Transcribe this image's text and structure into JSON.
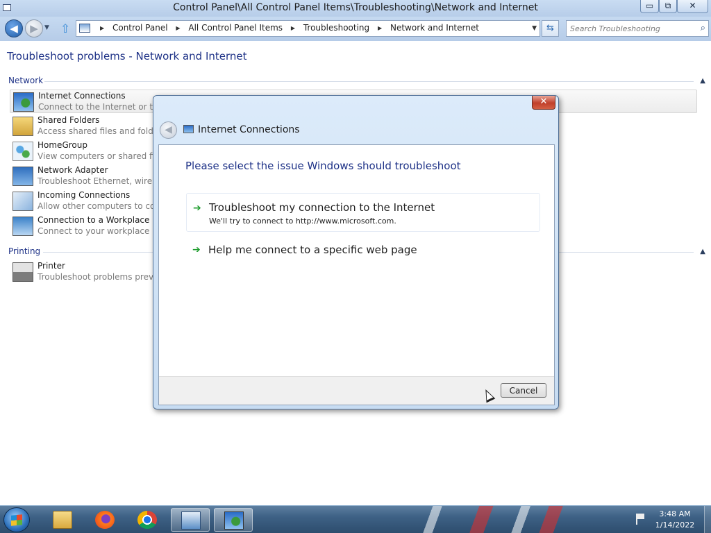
{
  "window": {
    "title": "Control Panel\\All Control Panel Items\\Troubleshooting\\Network and Internet",
    "minimize": "▭",
    "maximize": "⧉",
    "close": "✕"
  },
  "address_bar": {
    "breadcrumbs": [
      "Control Panel",
      "All Control Panel Items",
      "Troubleshooting",
      "Network and Internet"
    ],
    "search_placeholder": "Search Troubleshooting"
  },
  "page": {
    "title": "Troubleshoot problems - Network and Internet",
    "sections": [
      {
        "label": "Network",
        "items": [
          {
            "name": "Internet Connections",
            "desc": "Connect to the Internet or to a",
            "icon": "internet-connections-icon"
          },
          {
            "name": "Shared Folders",
            "desc": "Access shared files and folders o",
            "icon": "shared-folders-icon"
          },
          {
            "name": "HomeGroup",
            "desc": "View computers or shared files",
            "icon": "homegroup-icon"
          },
          {
            "name": "Network Adapter",
            "desc": "Troubleshoot Ethernet, wireless,",
            "icon": "network-adapter-icon"
          },
          {
            "name": "Incoming Connections",
            "desc": "Allow other computers to comm",
            "icon": "incoming-connections-icon"
          },
          {
            "name": "Connection to a Workplace Usin",
            "desc": "Connect to your workplace netw",
            "icon": "workplace-icon"
          }
        ]
      },
      {
        "label": "Printing",
        "items": [
          {
            "name": "Printer",
            "desc": "Troubleshoot problems prevent",
            "icon": "printer-icon"
          }
        ]
      }
    ]
  },
  "dialog": {
    "title": "Internet Connections",
    "close_label": "✕",
    "heading": "Please select the issue Windows should troubleshoot",
    "options": [
      {
        "title": "Troubleshoot my connection to the Internet",
        "subtitle": "We'll try to connect to http://www.microsoft.com."
      },
      {
        "title": "Help me connect to a specific web page",
        "subtitle": ""
      }
    ],
    "cancel_label": "Cancel"
  },
  "taskbar": {
    "pinned": [
      "windows-explorer",
      "firefox",
      "chrome",
      "control-panel",
      "troubleshooting"
    ],
    "time": "3:48 AM",
    "date": "1/14/2022"
  },
  "colors": {
    "accent_text": "#1e3287",
    "link_arrow": "#1f9d2f",
    "dialog_close": "#c0402b"
  }
}
